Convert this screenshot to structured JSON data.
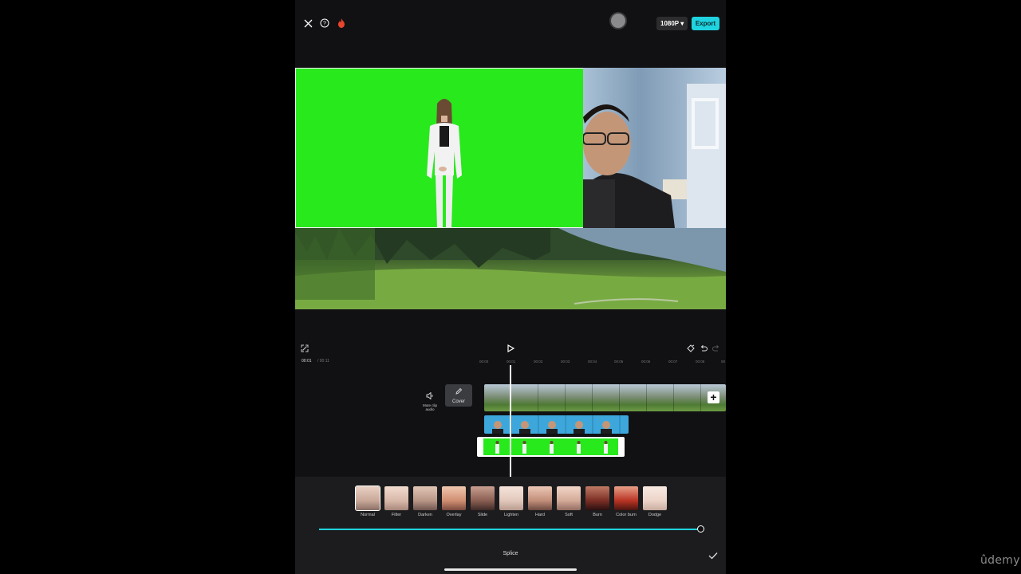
{
  "toolbar": {
    "resolution_label": "1080P ▾",
    "export_label": "Export"
  },
  "timeline": {
    "current_time": "00:01",
    "total_time": "/ 00:11",
    "ticks": [
      "00:00",
      "00:01",
      "00:02",
      "00:03",
      "00:04",
      "00:05",
      "00:06",
      "00:07",
      "00:08",
      "00"
    ],
    "mute_label_line1": "Mute clip",
    "mute_label_line2": "audio",
    "cover_label": "Cover",
    "add_label": "+"
  },
  "blend": {
    "title": "Splice",
    "selected_mode": "Normal",
    "opacity": 1.0,
    "modes": [
      "Normal",
      "Filter",
      "Darken",
      "Overlay",
      "Slide",
      "Lighten",
      "Hard",
      "Soft",
      "Burn",
      "Color burn",
      "Dodge"
    ]
  },
  "colors": {
    "accent": "#1fd3e0",
    "chroma_green": "#27e91c",
    "background": "#111113",
    "panel": "#1c1c1e"
  },
  "watermark": "ûdemy"
}
